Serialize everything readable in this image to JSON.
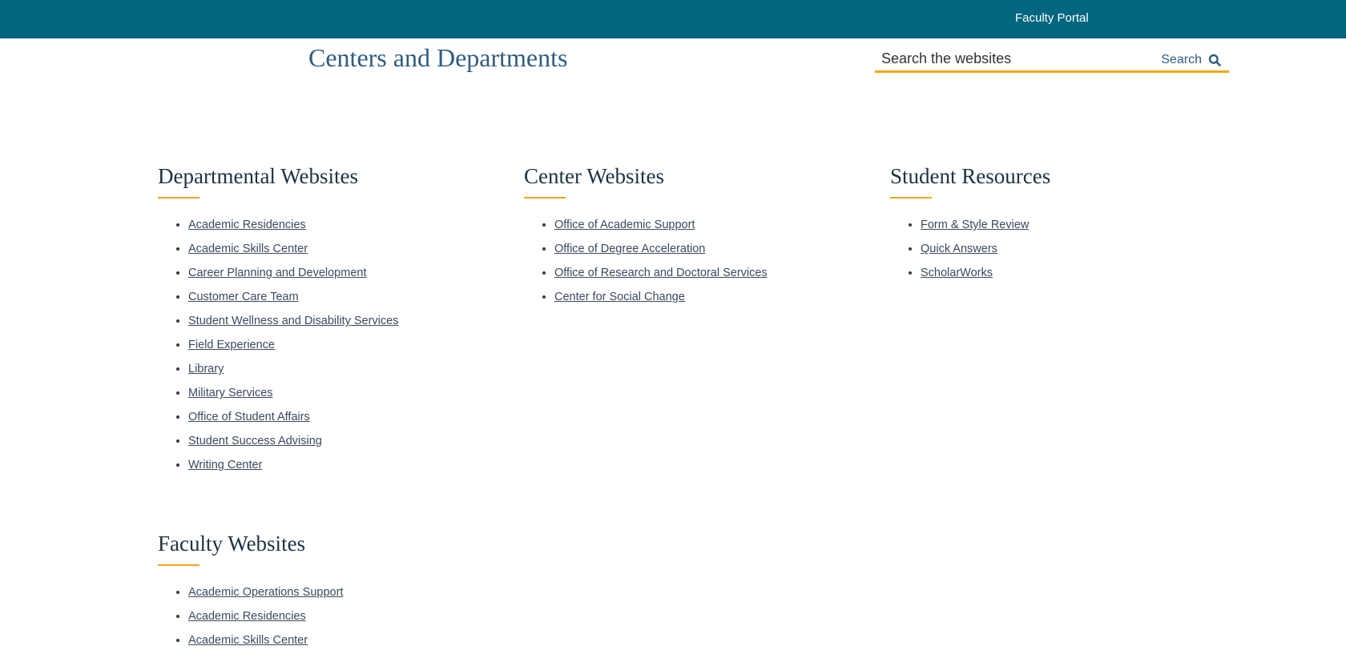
{
  "header": {
    "faculty_portal": "Faculty Portal",
    "colors": {
      "bar": "#026680",
      "accent": "#f3a618",
      "title": "#2f5c80"
    }
  },
  "page": {
    "title": "Centers and Departments"
  },
  "search": {
    "placeholder": "Search the websites",
    "button_label": "Search",
    "icon": "search-icon"
  },
  "sections": {
    "departmental": {
      "heading": "Departmental Websites",
      "links": [
        "Academic Residencies",
        "Academic Skills Center",
        "Career Planning and Development",
        "Customer Care Team",
        "Student Wellness and Disability Services",
        "Field Experience",
        "Library",
        "Military Services",
        "Office of Student Affairs",
        "Student Success Advising",
        "Writing Center"
      ]
    },
    "center": {
      "heading": "Center Websites",
      "links": [
        "Office of Academic Support",
        "Office of Degree Acceleration",
        "Office of Research and Doctoral Services",
        "Center for Social Change"
      ]
    },
    "student": {
      "heading": "Student Resources",
      "links": [
        "Form & Style Review",
        "Quick Answers",
        "ScholarWorks"
      ]
    },
    "faculty": {
      "heading": "Faculty Websites",
      "links": [
        "Academic Operations Support",
        "Academic Residencies",
        "Academic Skills Center"
      ]
    }
  }
}
